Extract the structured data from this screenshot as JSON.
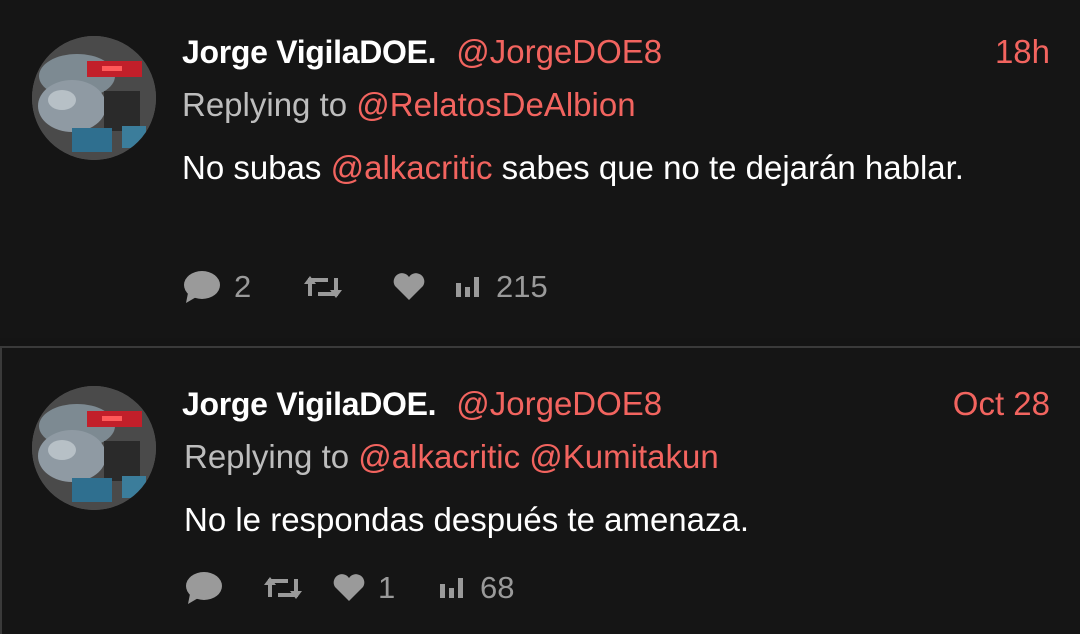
{
  "tweets": [
    {
      "author_name": "Jorge VigilaDOE.",
      "handle": "@JorgeDOE8",
      "time": "18h",
      "replying_prefix": "Replying to ",
      "replying_to": [
        "@RelatosDeAlbion"
      ],
      "text_before": "No subas ",
      "text_mention": "@alkacritic",
      "text_after": " sabes que no te dejarán hablar.",
      "replies": "2",
      "retweets": "",
      "likes": "",
      "views": "215"
    },
    {
      "author_name": "Jorge VigilaDOE.",
      "handle": "@JorgeDOE8",
      "time": "Oct 28",
      "replying_prefix": "Replying to ",
      "replying_to": [
        "@alkacritic",
        "@Kumitakun"
      ],
      "text": "No le respondas después te amenaza.",
      "replies": "",
      "retweets": "",
      "likes": "1",
      "views": "68"
    }
  ],
  "colors": {
    "background": "#151515",
    "accent": "#f2645f",
    "text": "#ffffff",
    "muted": "#9a9a9a"
  },
  "icons": [
    "reply-icon",
    "retweet-icon",
    "like-icon",
    "views-icon"
  ]
}
